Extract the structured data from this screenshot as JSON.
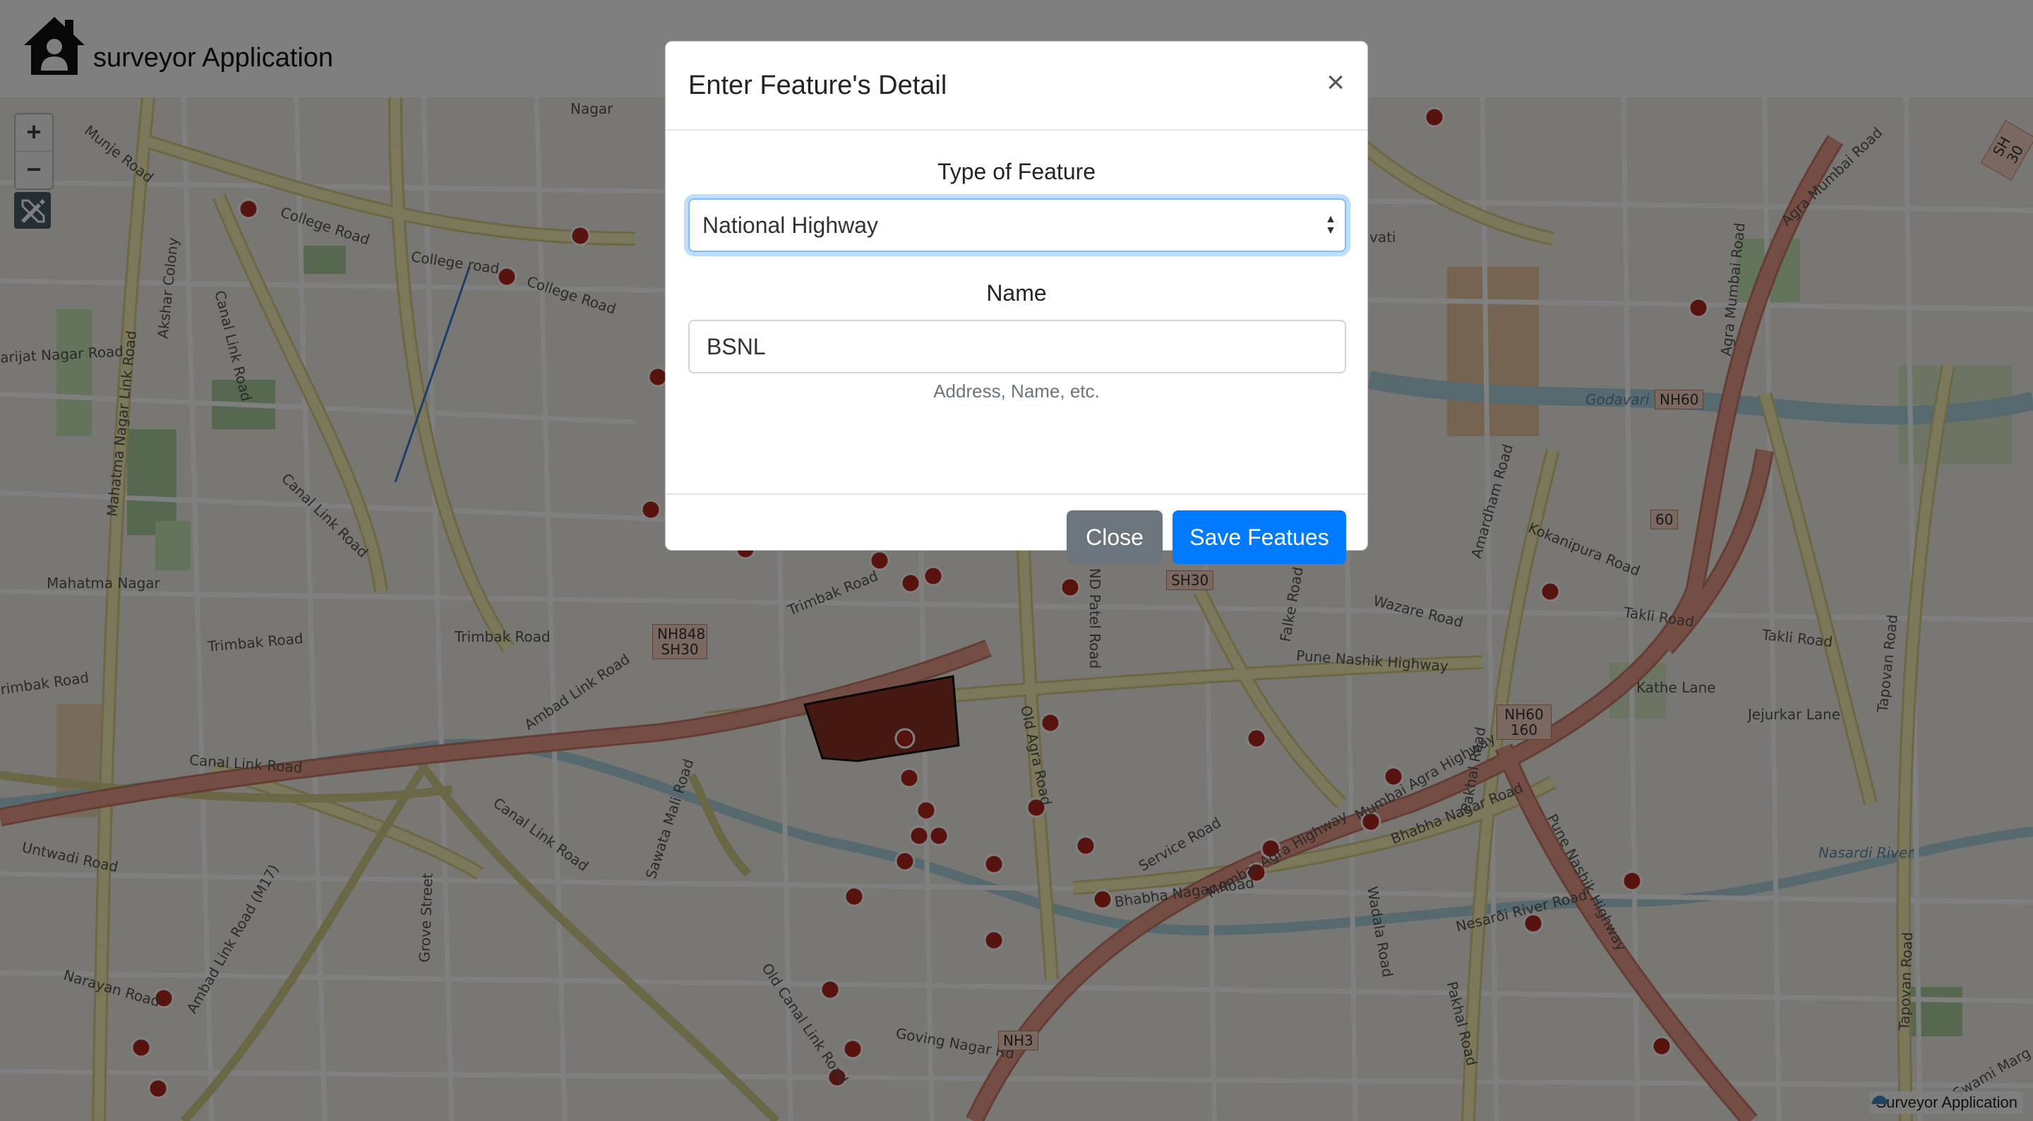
{
  "header": {
    "title": "surveyor Application",
    "logo_icon": "home-icon"
  },
  "map": {
    "zoom_in": "+",
    "zoom_out": "−",
    "attribution": "Surveyor Application",
    "labels": {
      "college_road_1": "College Road",
      "college_road_2": "College road",
      "college_road_3": "College Road",
      "canal_link_road_1": "Canal Link Road",
      "canal_link_road_2": "Canal Link Road",
      "canal_link_road_3": "Canal Link Road",
      "canal_link_road_4": "Canal Link Road",
      "trimbak_road_1": "Trimbak Road",
      "trimbak_road_2": "Trimbak Road",
      "trimbak_road_3": "Trimbak Road",
      "trimbak_road_4": "rimbak Road",
      "ambad_link_road": "Ambad Link Road",
      "ambad_link_road_m17": "Ambad Link Road (M17)",
      "mahatma_nagar_link_road": "Mahatma Nagar Link Road",
      "mahatma_nagar": "Mahatma Nagar",
      "arijat_nagar_road": "arijat Nagar Road",
      "munje_road": "Munje Road",
      "akshar_colony": "Akshar Colony",
      "nagar": "Nagar",
      "sawata_mali_road": "Sawata Mali Road",
      "old_agra_road": "Old Agra Road",
      "nd_patel_road": "ND Patel Road",
      "old_canal_link_road": "Old Canal Link Road",
      "goving_nagar_road": "Goving Nagar Rd",
      "grove_street": "Grove Street",
      "untwadi_road": "Untwadi Road",
      "narayan_road": "Narayan Road",
      "pune_nashik_highway_1": "Pune Nashik Highway",
      "pune_nashik_highway_2": "Pune Nashik Highway",
      "mumbai_agra_highway_1": "Mumbai Agra Highway",
      "mumbai_agra_highway_2": "Mumbai Agra Highway",
      "agra_mumbai_road_1": "Agra Mumbai Road",
      "agra_mumbai_road_2": "Agra Mumbai Road",
      "wazare_road": "Wazare Road",
      "kokanipura_road": "Kokanipura Road",
      "takli_road_1": "Takli Road",
      "takli_road_2": "Takli Road",
      "kathe_lane": "Kathe Lane",
      "jejurkar_lane": "Jejurkar Lane",
      "tapovan_road_1": "Tapovan Road",
      "tapovan_road_2": "Tapovan Road",
      "bhabha_nagar_road_1": "Bhabha Nagar Road",
      "bhabha_nagar_road_2": "Bhabha Nagar Road",
      "service_road": "Service Road",
      "wadala_road": "Wadala Road",
      "nesarði_river_road": "Nesarði River Road",
      "pakhal_road_1": "Pakhal Road",
      "pakhal_road_2": "Pakhal Road",
      "nasardi_river": "Nasardi River",
      "godavari": "Godavari",
      "amardham_road": "Amardham Road",
      "falke_road": "Falke Road",
      "swami_marg": "Swami Marg",
      "vati": "vati"
    },
    "shields": {
      "nh848": "NH848",
      "sh30_a": "SH30",
      "sh30_b": "SH30",
      "sh30_c": "SH 30",
      "nh60_a": "NH60",
      "nh60_b": "NH60",
      "n160": "160",
      "n60": "60",
      "nh3": "NH3"
    }
  },
  "modal": {
    "title": "Enter Feature's Detail",
    "close_symbol": "×",
    "type_label": "Type of Feature",
    "type_selected": "National Highway",
    "name_label": "Name",
    "name_value": "BSNL",
    "help_text": "Address, Name, etc.",
    "close_button": "Close",
    "save_button": "Save Featues"
  },
  "colors": {
    "primary": "#007bff",
    "secondary": "#6c757d",
    "marker": "#b3261e",
    "trunk_road": "#e89a88",
    "secondary_road": "#f6f0b8",
    "river": "#aad3df"
  }
}
